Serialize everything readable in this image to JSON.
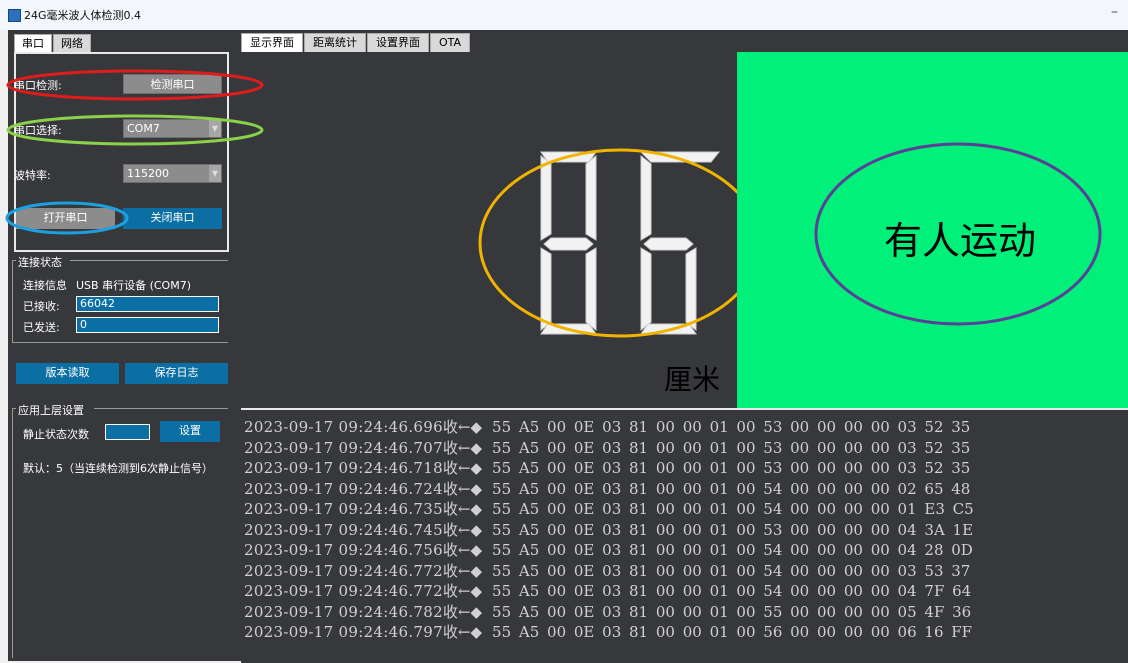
{
  "window": {
    "title": "24G毫米波人体检测0.4",
    "minimize": "–"
  },
  "left_tabs": [
    "串口",
    "网络"
  ],
  "serial": {
    "detect_label": "串口检测:",
    "detect_button": "检测串口",
    "port_label": "串口选择:",
    "port_value": "COM7",
    "baud_label": "波特率:",
    "baud_value": "115200",
    "open_button": "打开串口",
    "close_button": "关闭串口"
  },
  "connection": {
    "group_title": "连接状态",
    "info_label": "连接信息",
    "info_value": "USB 串行设备 (COM7)",
    "received_label": "已接收:",
    "received_value": "66042",
    "sent_label": "已发送:",
    "sent_value": "0"
  },
  "actions": {
    "read_version": "版本读取",
    "save_log": "保存日志"
  },
  "app_settings": {
    "group_title": "应用上层设置",
    "static_label": "静止状态次数",
    "static_value": "",
    "set_button": "设置",
    "default_note": "默认：5（当连续检测到6次静止信号）"
  },
  "content_tabs": [
    "显示界面",
    "距离统计",
    "设置界面",
    "OTA"
  ],
  "display": {
    "distance_value": "86",
    "unit": "厘米",
    "status": "有人运动",
    "colors": {
      "status_bg": "#00f07a",
      "segment": "#f2f2f2"
    }
  },
  "log": {
    "arrow": "收←◆",
    "lines": [
      {
        "ts": "2023-09-17 09:24:46.696",
        "hex": "55 A5 00 0E 03 81 00 00 01 00 53 00 00 00 00 03 52 35"
      },
      {
        "ts": "2023-09-17 09:24:46.707",
        "hex": "55 A5 00 0E 03 81 00 00 01 00 53 00 00 00 00 03 52 35"
      },
      {
        "ts": "2023-09-17 09:24:46.718",
        "hex": "55 A5 00 0E 03 81 00 00 01 00 53 00 00 00 00 03 52 35"
      },
      {
        "ts": "2023-09-17 09:24:46.724",
        "hex": "55 A5 00 0E 03 81 00 00 01 00 54 00 00 00 00 02 65 48"
      },
      {
        "ts": "2023-09-17 09:24:46.735",
        "hex": "55 A5 00 0E 03 81 00 00 01 00 54 00 00 00 00 01 E3 C5"
      },
      {
        "ts": "2023-09-17 09:24:46.745",
        "hex": "55 A5 00 0E 03 81 00 00 01 00 53 00 00 00 00 04 3A 1E"
      },
      {
        "ts": "2023-09-17 09:24:46.756",
        "hex": "55 A5 00 0E 03 81 00 00 01 00 54 00 00 00 00 04 28 0D"
      },
      {
        "ts": "2023-09-17 09:24:46.772",
        "hex": "55 A5 00 0E 03 81 00 00 01 00 54 00 00 00 00 03 53 37"
      },
      {
        "ts": "2023-09-17 09:24:46.772",
        "hex": "55 A5 00 0E 03 81 00 00 01 00 54 00 00 00 00 04 7F 64"
      },
      {
        "ts": "2023-09-17 09:24:46.782",
        "hex": "55 A5 00 0E 03 81 00 00 01 00 55 00 00 00 00 05 4F 36"
      },
      {
        "ts": "2023-09-17 09:24:46.797",
        "hex": "55 A5 00 0E 03 81 00 00 01 00 56 00 00 00 00 06 16 FF"
      }
    ]
  },
  "annotations": [
    {
      "target": "detect-serial-row",
      "color": "#e01b1b"
    },
    {
      "target": "port-select-row",
      "color": "#8bd14a"
    },
    {
      "target": "open-serial-button",
      "color": "#1ba0e0"
    },
    {
      "target": "distance-readout",
      "color": "#f0b400"
    },
    {
      "target": "status-indicator",
      "color": "#5a3e9a"
    }
  ]
}
